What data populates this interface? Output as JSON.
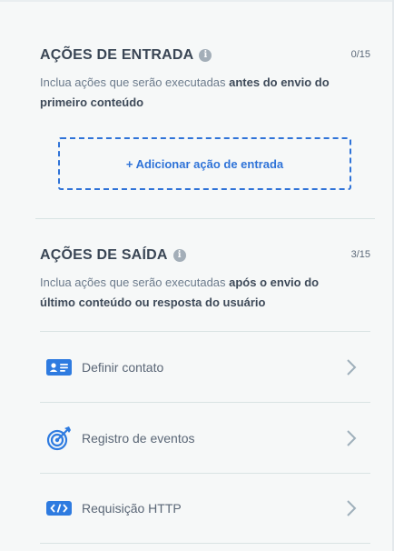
{
  "entry": {
    "title": "AÇÕES DE ENTRADA",
    "count": "0/15",
    "desc_prefix": "Inclua ações que serão executadas ",
    "desc_bold": "antes do envio do primeiro conteúdo",
    "add_label": "+ Adicionar ação de entrada"
  },
  "exit": {
    "title": "AÇÕES DE SAÍDA",
    "count": "3/15",
    "desc_prefix": "Inclua ações que serão executadas ",
    "desc_bold": "após o envio do último conteúdo ou resposta do usuário"
  },
  "actions": [
    {
      "label": "Definir contato",
      "icon": "contact-card-icon"
    },
    {
      "label": "Registro de eventos",
      "icon": "target-icon"
    },
    {
      "label": "Requisição HTTP",
      "icon": "code-icon"
    }
  ],
  "colors": {
    "accent": "#2f73d8",
    "icon_blue": "#2e7be0"
  }
}
